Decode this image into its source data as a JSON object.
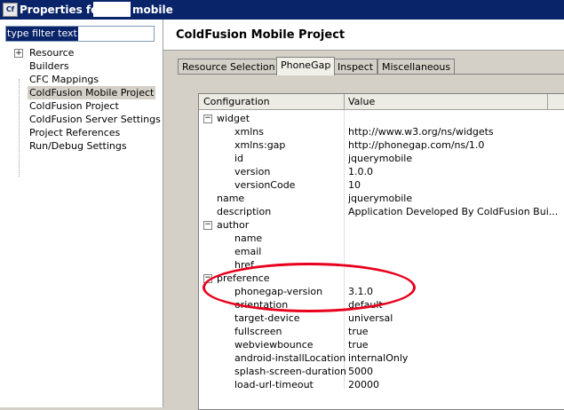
{
  "window": {
    "title_left": "Properties for",
    "title_right": "mobile",
    "icon_text": "Cf"
  },
  "sidebar": {
    "filter_placeholder": "type filter text",
    "items": [
      {
        "label": "Resource",
        "expandable": true
      },
      {
        "label": "Builders"
      },
      {
        "label": "CFC Mappings"
      },
      {
        "label": "ColdFusion Mobile Project",
        "selected": true
      },
      {
        "label": "ColdFusion Project"
      },
      {
        "label": "ColdFusion Server Settings"
      },
      {
        "label": "Project References"
      },
      {
        "label": "Run/Debug Settings"
      }
    ]
  },
  "page": {
    "title": "ColdFusion Mobile Project"
  },
  "tabs": [
    {
      "label": "Resource Selection"
    },
    {
      "label": "PhoneGap",
      "active": true
    },
    {
      "label": "Inspect"
    },
    {
      "label": "Miscellaneous"
    }
  ],
  "table": {
    "columns": [
      "Configuration",
      "Value"
    ],
    "rows": [
      {
        "key": "widget",
        "value": "",
        "level": 0,
        "group": true
      },
      {
        "key": "xmlns",
        "value": "http://www.w3.org/ns/widgets",
        "level": 2
      },
      {
        "key": "xmlns:gap",
        "value": "http://phonegap.com/ns/1.0",
        "level": 2
      },
      {
        "key": "id",
        "value": "jquerymobile",
        "level": 2
      },
      {
        "key": "version",
        "value": "1.0.0",
        "level": 2
      },
      {
        "key": "versionCode",
        "value": "10",
        "level": 2
      },
      {
        "key": "name",
        "value": "jquerymobile",
        "level": 1
      },
      {
        "key": "description",
        "value": "Application Developed By ColdFusion Bui...",
        "level": 1
      },
      {
        "key": "author",
        "value": "",
        "level": 0,
        "group": true
      },
      {
        "key": "name",
        "value": "",
        "level": 2
      },
      {
        "key": "email",
        "value": "",
        "level": 2
      },
      {
        "key": "href",
        "value": "",
        "level": 2
      },
      {
        "key": "preference",
        "value": "",
        "level": 0,
        "group": true
      },
      {
        "key": "phonegap-version",
        "value": "3.1.0",
        "level": 2
      },
      {
        "key": "orientation",
        "value": "default",
        "level": 2
      },
      {
        "key": "target-device",
        "value": "universal",
        "level": 2
      },
      {
        "key": "fullscreen",
        "value": "true",
        "level": 2
      },
      {
        "key": "webviewbounce",
        "value": "true",
        "level": 2
      },
      {
        "key": "android-installLocation",
        "value": "internalOnly",
        "level": 2
      },
      {
        "key": "splash-screen-duration",
        "value": "5000",
        "level": 2
      },
      {
        "key": "load-url-timeout",
        "value": "20000",
        "level": 2
      }
    ]
  },
  "highlight_color": "#e8001c"
}
